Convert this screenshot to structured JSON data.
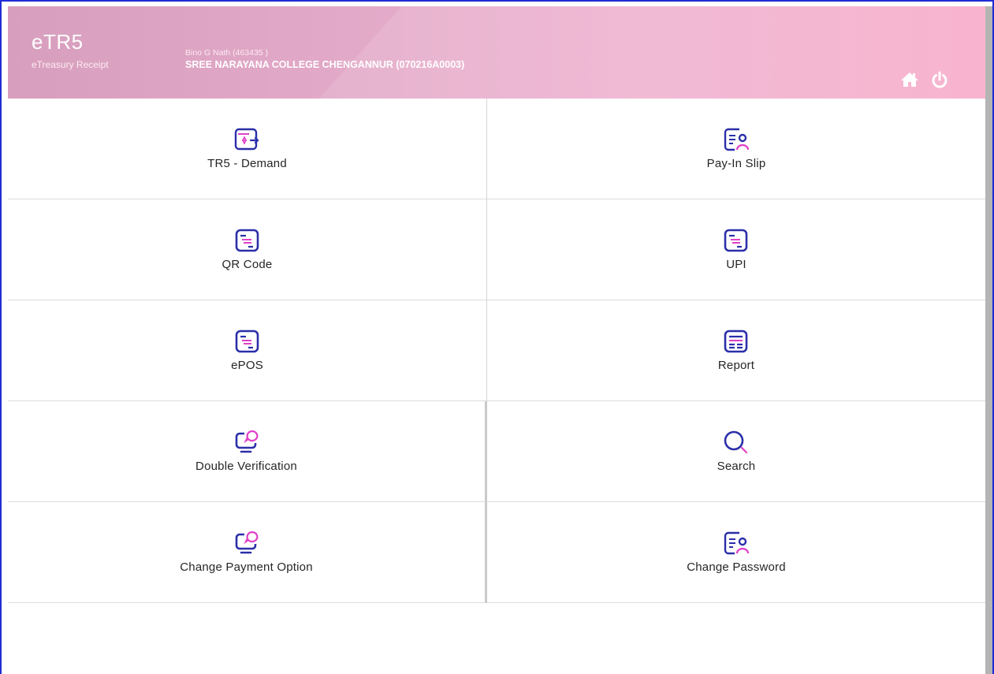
{
  "header": {
    "app_name": "eTR5",
    "app_subtitle": "eTreasury Receipt",
    "user": "Bino G Nath (463435 )",
    "office": "SREE NARAYANA COLLEGE CHENGANNUR (070216A0003)",
    "icons": [
      "home-icon",
      "power-icon"
    ]
  },
  "menu": [
    {
      "label": "TR5 - Demand",
      "icon": "demand-doc-icon"
    },
    {
      "label": "Pay-In Slip",
      "icon": "user-doc-icon"
    },
    {
      "label": "QR Code",
      "icon": "list-doc-icon"
    },
    {
      "label": "UPI",
      "icon": "list-doc-icon"
    },
    {
      "label": "ePOS",
      "icon": "list-doc-icon"
    },
    {
      "label": "Report",
      "icon": "report-icon"
    },
    {
      "label": "Double Verification",
      "icon": "monitor-chat-icon"
    },
    {
      "label": "Search",
      "icon": "search-icon"
    },
    {
      "label": "Change Payment Option",
      "icon": "monitor-chat-icon"
    },
    {
      "label": "Change Password",
      "icon": "user-doc-icon"
    }
  ],
  "colors": {
    "icon_primary": "#2b2fa8",
    "icon_accent": "#e040c8",
    "header_start": "#d79fbd",
    "header_end": "#f7aac8",
    "frame": "#1f2bd6"
  }
}
